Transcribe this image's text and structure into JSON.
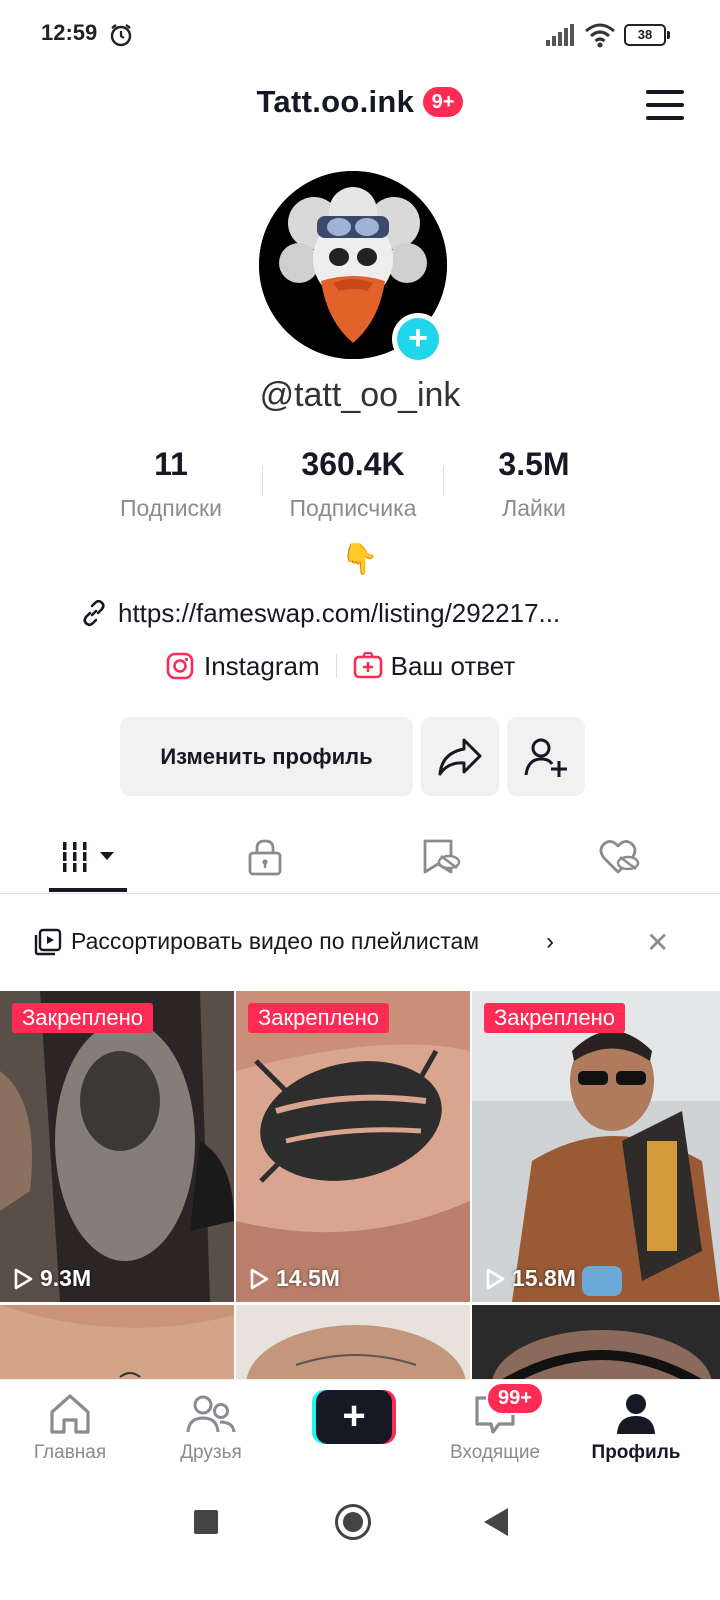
{
  "status_bar": {
    "time": "12:59",
    "battery": "38"
  },
  "header": {
    "title": "Tatt.oo.ink",
    "notification_badge": "9+"
  },
  "profile": {
    "username": "@tatt_oo_ink",
    "stats": [
      {
        "value": "11",
        "label": "Подписки"
      },
      {
        "value": "360.4K",
        "label": "Подписчика"
      },
      {
        "value": "3.5M",
        "label": "Лайки"
      }
    ],
    "bio_emoji": "👇",
    "link": "https://fameswap.com/listing/292217...",
    "instagram_label": "Instagram",
    "answer_label": "Ваш ответ"
  },
  "actions": {
    "edit_profile_label": "Изменить профиль"
  },
  "playlist_banner": {
    "text": "Рассортировать видео по плейлистам"
  },
  "videos": [
    {
      "pinned_label": "Закреплено",
      "views": "9.3M"
    },
    {
      "pinned_label": "Закреплено",
      "views": "14.5M"
    },
    {
      "pinned_label": "Закреплено",
      "views": "15.8M"
    }
  ],
  "bottom_nav": {
    "home": "Главная",
    "friends": "Друзья",
    "inbox": "Входящие",
    "inbox_badge": "99+",
    "profile": "Профиль"
  },
  "colors": {
    "accent": "#FE2C55",
    "cyan": "#20D5EC",
    "text": "#161823",
    "muted": "#8A8B91"
  }
}
